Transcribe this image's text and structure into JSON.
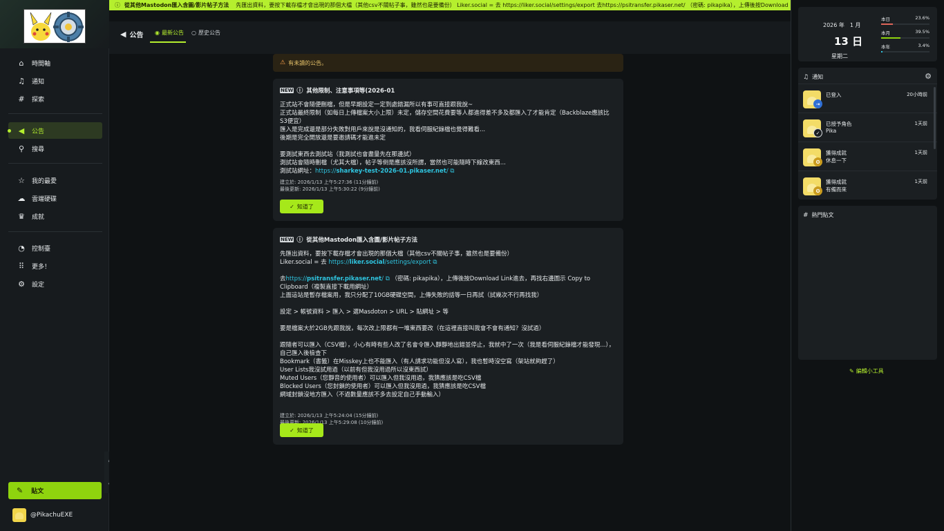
{
  "marquee": {
    "title": "從其他Mastodon匯入含圖/影片帖子方法",
    "text": "先匯出資料，要按下載存檔才會出現的那個大檔（其他csv不關帖子事，雖然也是要備份） Liker.social = 去 https://liker.social/settings/export 去https://psitransfer.pikaser.net/ （密碼: pikapika），上傳後按Download ..."
  },
  "sidebar": {
    "items": [
      {
        "label": "時間軸",
        "icon": "home-icon"
      },
      {
        "label": "通知",
        "icon": "bell-icon"
      },
      {
        "label": "探索",
        "icon": "hash-icon"
      },
      {
        "label": "公告",
        "icon": "megaphone-icon"
      },
      {
        "label": "搜尋",
        "icon": "search-icon"
      },
      {
        "label": "我的最愛",
        "icon": "star-icon"
      },
      {
        "label": "雲端硬碟",
        "icon": "cloud-icon"
      },
      {
        "label": "成就",
        "icon": "trophy-icon"
      },
      {
        "label": "控制臺",
        "icon": "dashboard-icon"
      },
      {
        "label": "更多！",
        "icon": "grid-icon"
      },
      {
        "label": "設定",
        "icon": "gear-icon"
      }
    ],
    "post_label": "貼文",
    "account": "@PikachuEXE"
  },
  "header": {
    "title": "公告",
    "tabs": [
      {
        "label": "最新公告"
      },
      {
        "label": "歷史公告"
      }
    ]
  },
  "unread_notice": "有未讀的公告。",
  "announcements": [
    {
      "title": "其他限制、注意事項等(2026-01",
      "paragraphs": [
        "正式站不會隨便刪檔，但是早期設定一定到處錯漏所以有事可直接跟我說~",
        "正式站最終限制（如每日上傳檔案大小上限）未定，儲存空間花費要等人都進得差不多及都匯入了才能肯定（Backblaze應該比S3便宜）",
        "匯入是完成還是部分失敗對用戶來說是沒通知的，我看伺服紀錄檔也覺得難看...",
        "後期是完全開放還是要邀請碼才能進未定",
        "",
        "要測試東西去測試站（我測試也會盡量先在那邊試）",
        "測試站會隨時刪檔（尤其大檔），帖子等倒是應該沒所謂，當然也可能隨時下線改東西..."
      ],
      "test_site_prefix": "測試站網址：",
      "test_site_scheme": "https://",
      "test_site_host": "sharkey-test-2026-01.pikaser.net",
      "test_site_path": "/",
      "created": "建立於: 2026/1/13 上午5:27:36 (11分鐘前)",
      "updated": "最後更新: 2026/1/13 上午5:30:22 (9分鐘前)",
      "ok_label": "知道了"
    },
    {
      "title": "從其他Mastodon匯入含圖/影片帖子方法",
      "line1": "先匯出資料，要按下載存檔才會出現的那個大檔（其他csv不關帖子事，雖然也是要備份）",
      "liker_prefix": "Liker.social = 去",
      "liker_scheme": "https://",
      "liker_host": "liker.social",
      "liker_path": "/settings/export",
      "psi_prefix": "去",
      "psi_scheme": "https://",
      "psi_host": "psitransfer.pikaser.net",
      "psi_path": "/",
      "psi_suffix": "（密碼: pikapika），上傳後按Download Link進去，再找右邊圖示 Copy to Clipboard（複製直接下載用網址）",
      "lines_a": [
        "上面這站是暫存檔案用，我只分配了10GB硬碟空間，上傳失敗的話等一日再試（試幾次不行再找我）",
        "",
        "設定 > 帳號資料 > 匯入 > 選Masdoton > URL > 貼網址 > 等",
        "",
        "要是檔案大於2GB先跟我說，每次改上限都有一堆東西要改（在這裡直接叫我會不會有通知？沒試過）",
        "",
        "跟隨者可以匯入（CSV檔），小心有時有些人改了名會令匯入靜靜地出錯並停止，我就中了一次（我是看伺服紀錄檔才能發現...），自己匯入後檢查下",
        "Bookmark（書籤）在Misskey上也不能匯入（有人請求功能但沒人寫），我也暫時沒空寫（架站就夠趕了）",
        "User Lists我沒試用過（以前有但我沒用過所以沒東西試）",
        "Muted Users（您靜音的使用者）可以匯入但我沒用過，我猜應該是吃CSV檔",
        "Blocked Users（您封鎖的使用者）可以匯入但我沒用過，我猜應該是吃CSV檔",
        "網域封鎖沒地方匯入（不過數量應該不多去設定自己手動輸入）"
      ],
      "created": "建立於: 2026/1/13 上午5:24:04 (15分鐘前)",
      "updated": "最後更新: 2026/1/13 上午5:29:08 (10分鐘前)",
      "ok_label": "知道了"
    }
  ],
  "calendar": {
    "year_month": "2026 年　1 月",
    "day": "13 日",
    "weekday": "星期二",
    "stats": [
      {
        "label": "本日",
        "value": "23.6%",
        "fraction": 0.236,
        "color": "#e0665a"
      },
      {
        "label": "本月",
        "value": "39.5%",
        "fraction": 0.395,
        "color": "#8fd40e"
      },
      {
        "label": "本年",
        "value": "3.4%",
        "fraction": 0.034,
        "color": "#2fc5e0"
      }
    ]
  },
  "notifications": {
    "title": "通知",
    "items": [
      {
        "title": "已登入",
        "detail": "",
        "time": "20小時前",
        "badge_color": "#2f6fd6",
        "badge_icon": "login-icon"
      },
      {
        "title": "已授予角色",
        "detail": "Pika",
        "time": "1天前",
        "badge_color": "#1b1f22",
        "badge_icon": "check-icon"
      },
      {
        "title": "獲得成就",
        "detail": "休息一下",
        "time": "1天前",
        "badge_color": "#c99b1e",
        "badge_icon": "medal-icon"
      },
      {
        "title": "獲得成就",
        "detail": "有備而來",
        "time": "1天前",
        "badge_color": "#c99b1e",
        "badge_icon": "medal-icon"
      }
    ]
  },
  "trending": {
    "title": "熱門貼文"
  },
  "edit_widgets": "編輯小工具"
}
